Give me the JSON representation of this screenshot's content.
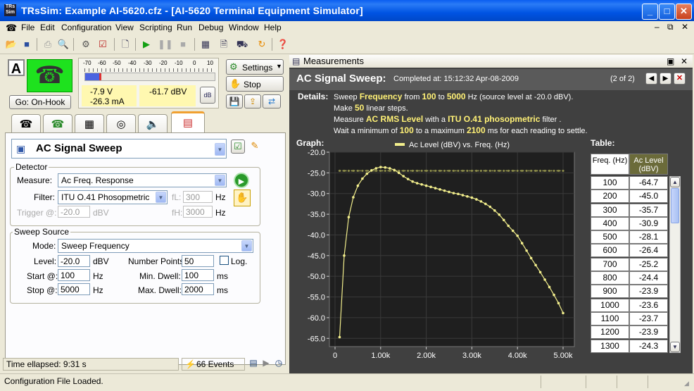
{
  "window": {
    "title": "TRsSim:  Example AI-5620.cfz - [AI-5620  Terminal Equipment Simulator]",
    "app_icon_text": "TRs Sim"
  },
  "menu": [
    "File",
    "Edit",
    "Configuration",
    "View",
    "Scripting",
    "Run",
    "Debug",
    "Window",
    "Help"
  ],
  "phone": {
    "letter": "A",
    "go_button": "Go:  On-Hook"
  },
  "meter": {
    "scale": [
      "-70",
      "-60",
      "-50",
      "-40",
      "-30",
      "-20",
      "-10",
      "0",
      "10"
    ],
    "voltage": "-7.9  V",
    "current": "-26.3 mA",
    "level": "-61.7 dBV",
    "settings_label": "Settings",
    "stop_label": "Stop"
  },
  "measure": {
    "title": "AC Signal Sweep",
    "detector": {
      "legend": "Detector",
      "measure_label": "Measure:",
      "measure_value": "Ac Freq. Response",
      "filter_label": "Filter:",
      "filter_value": "ITU O.41 Phosopmetric",
      "fl_label": "fL:",
      "fl_value": "300",
      "fh_label": "fH:",
      "fh_value": "3000",
      "hz1": "Hz",
      "hz2": "Hz",
      "trigger_label": "Trigger @:",
      "trigger_value": "-20.0",
      "trigger_unit": "dBV"
    },
    "sweep": {
      "legend": "Sweep Source",
      "mode_label": "Mode:",
      "mode_value": "Sweep Frequency",
      "level_label": "Level:",
      "level_value": "-20.0",
      "level_unit": "dBV",
      "points_label": "Number Points:",
      "points_value": "50",
      "log_label": "Log.",
      "start_label": "Start @:",
      "start_value": "100",
      "start_unit": "Hz",
      "mindwell_label": "Min. Dwell:",
      "mindwell_value": "100",
      "mindwell_unit": "ms",
      "stop_label": "Stop @:",
      "stop_value": "5000",
      "stop_unit": "Hz",
      "maxdwell_label": "Max. Dwell:",
      "maxdwell_value": "2000",
      "maxdwell_unit": "ms"
    }
  },
  "left_status": {
    "elapsed": "Time ellapsed:  9:31 s",
    "events": "66 Events"
  },
  "status_bar": {
    "message": "Configuration File Loaded."
  },
  "measurements": {
    "window_title": "Measurements",
    "header_title": "AC Signal Sweep:",
    "completed": "Completed at:  15:12:32  Apr-08-2009",
    "page": "(2 of 2)",
    "details_label": "Details:",
    "details": {
      "l1": [
        "Sweep ",
        "Frequency",
        " from ",
        "100",
        " to ",
        "5000",
        "  Hz  (source level at -20.0 dBV)."
      ],
      "l2": [
        "Make ",
        "50",
        "  linear steps."
      ],
      "l3": [
        "Measure ",
        "AC RMS Level",
        " with a ",
        "ITU O.41 phosopmetric",
        " filter ."
      ],
      "l4": [
        "Wait a minimum of ",
        "100",
        " to a maximum ",
        "2100",
        " ms for each reading to settle."
      ]
    },
    "graph_label": "Graph:",
    "table_label": "Table:",
    "table_headers": [
      "Freq. (Hz)",
      "Ac Level (dBV)"
    ],
    "table_rows": [
      [
        "100",
        "-64.7"
      ],
      [
        "200",
        "-45.0"
      ],
      [
        "300",
        "-35.7"
      ],
      [
        "400",
        "-30.9"
      ],
      [
        "500",
        "-28.1"
      ],
      [
        "600",
        "-26.4"
      ],
      [
        "700",
        "-25.2"
      ],
      [
        "800",
        "-24.4"
      ],
      [
        "900",
        "-23.9"
      ],
      [
        "1000",
        "-23.6"
      ],
      [
        "1100",
        "-23.7"
      ],
      [
        "1200",
        "-23.9"
      ],
      [
        "1300",
        "-24.3"
      ]
    ]
  },
  "chart_data": {
    "type": "line",
    "legend": "Ac Level (dBV)   vs.  Freq. (Hz)",
    "legend_placement": "top-center",
    "xlim": [
      0,
      5000
    ],
    "ylim": [
      -67,
      -20
    ],
    "xticks": [
      "0",
      "1.00k",
      "2.00k",
      "3.00k",
      "4.00k",
      "5.00k"
    ],
    "yticks": [
      "-20.0",
      "-25.0",
      "-30.0",
      "-35.0",
      "-40.0",
      "-45.0",
      "-50.0",
      "-55.0",
      "-60.0",
      "-65.0"
    ],
    "series_color": "#f2ee8c",
    "reference_color": "#8a8a4a",
    "reference_level": -24.5,
    "x": [
      100,
      200,
      300,
      400,
      500,
      600,
      700,
      800,
      900,
      1000,
      1100,
      1200,
      1300,
      1400,
      1500,
      1600,
      1700,
      1800,
      1900,
      2000,
      2100,
      2200,
      2300,
      2400,
      2500,
      2600,
      2700,
      2800,
      2900,
      3000,
      3100,
      3200,
      3300,
      3400,
      3500,
      3600,
      3700,
      3800,
      3900,
      4000,
      4100,
      4200,
      4300,
      4400,
      4500,
      4600,
      4700,
      4800,
      4900,
      5000
    ],
    "y": [
      -64.7,
      -45.0,
      -35.7,
      -30.9,
      -28.1,
      -26.4,
      -25.2,
      -24.4,
      -23.9,
      -23.6,
      -23.7,
      -23.9,
      -24.3,
      -25.0,
      -25.8,
      -26.5,
      -27.1,
      -27.5,
      -27.8,
      -28.1,
      -28.4,
      -28.7,
      -29.0,
      -29.3,
      -29.6,
      -29.9,
      -30.1,
      -30.4,
      -30.7,
      -31.0,
      -31.4,
      -31.9,
      -32.5,
      -33.2,
      -34.1,
      -35.1,
      -36.4,
      -37.8,
      -39.0,
      -40.2,
      -42.0,
      -43.8,
      -45.6,
      -47.3,
      -49.0,
      -50.8,
      -52.6,
      -54.5,
      -56.5,
      -58.9
    ]
  }
}
